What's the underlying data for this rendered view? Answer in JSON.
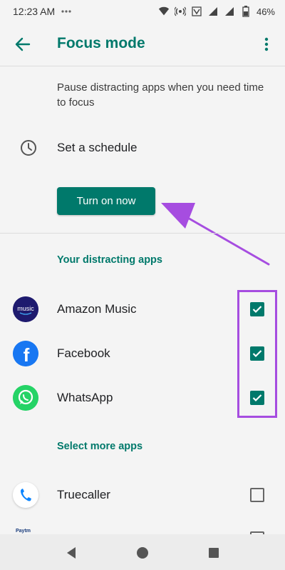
{
  "status_bar": {
    "time": "12:23 AM",
    "battery": "46%",
    "icons": [
      "more-notifications-icon",
      "wifi-icon",
      "hotspot-icon",
      "volte-icon",
      "signal-icon",
      "signal-icon",
      "battery-icon"
    ]
  },
  "app_bar": {
    "title": "Focus mode",
    "back_icon": "arrow-back-icon",
    "menu_icon": "more-vert-icon"
  },
  "description": "Pause distracting apps when you need time to focus",
  "schedule": {
    "label": "Set a schedule",
    "icon": "clock-icon"
  },
  "turn_on_button": "Turn on now",
  "sections": {
    "distracting_title": "Your distracting apps",
    "more_title": "Select more apps"
  },
  "distracting_apps": [
    {
      "name": "Amazon Music",
      "icon": "amazon-music-icon",
      "icon_text": "music",
      "checked": true
    },
    {
      "name": "Facebook",
      "icon": "facebook-icon",
      "icon_text": "f",
      "checked": true
    },
    {
      "name": "WhatsApp",
      "icon": "whatsapp-icon",
      "checked": true
    }
  ],
  "more_apps": [
    {
      "name": "Truecaller",
      "icon": "truecaller-icon",
      "checked": false
    }
  ],
  "partial_app": {
    "icon_text": "Paytm"
  },
  "nav_bar": {
    "back": "nav-back-icon",
    "home": "nav-home-icon",
    "recents": "nav-recents-icon"
  },
  "colors": {
    "accent": "#00796b",
    "annotation": "#a64de0",
    "background": "#f4f4f4"
  }
}
